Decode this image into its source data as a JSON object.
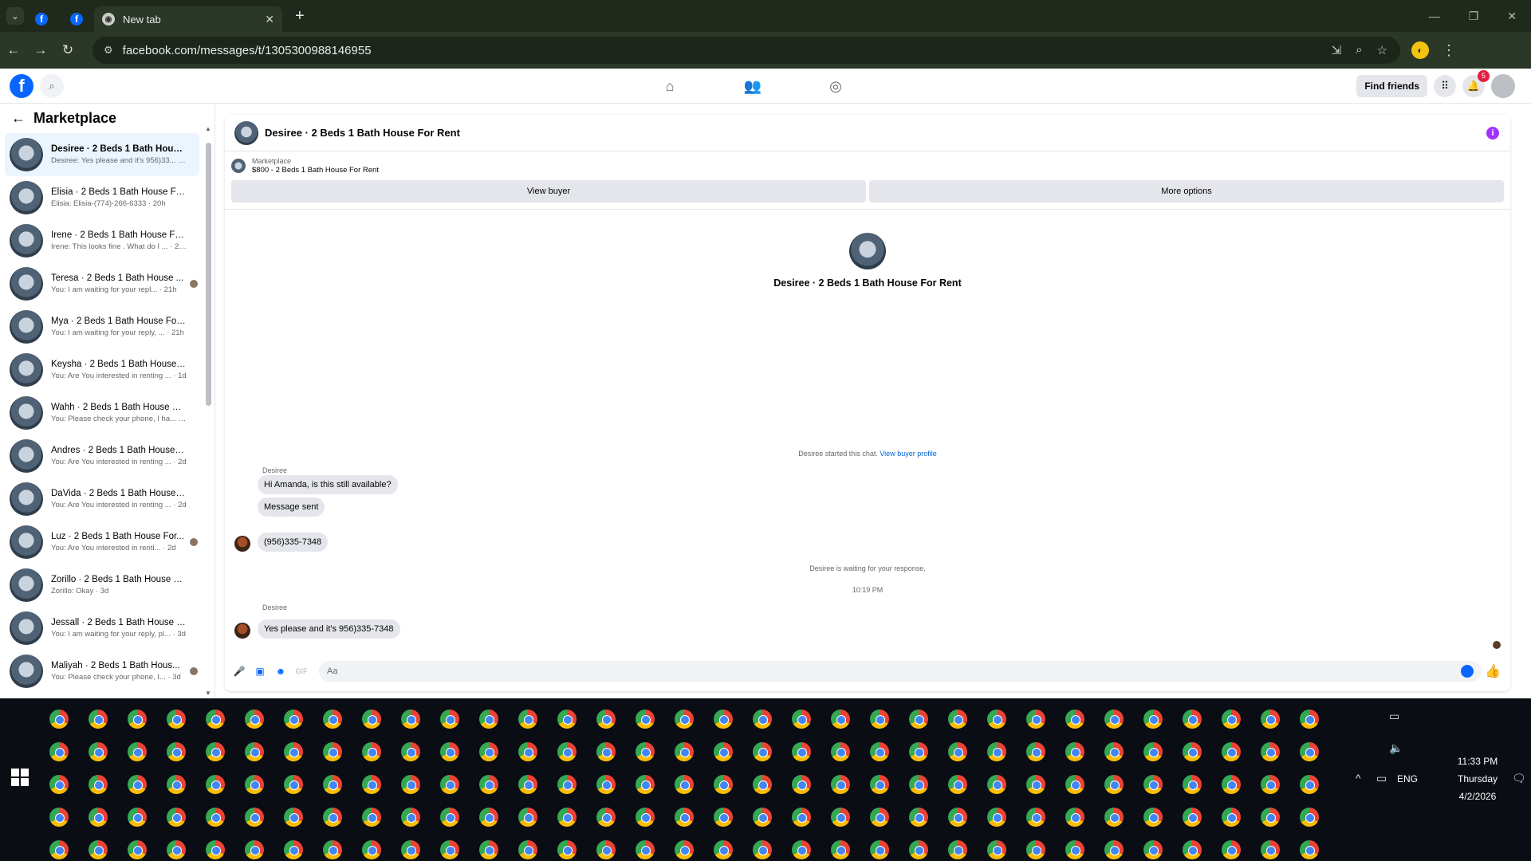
{
  "browser": {
    "tabs": [
      {
        "label": "",
        "icon": "facebook-icon"
      },
      {
        "label": "",
        "icon": "facebook-icon"
      },
      {
        "label": "New tab",
        "icon": "chrome-icon"
      }
    ],
    "url": "facebook.com/messages/t/1305300988146955"
  },
  "fb": {
    "find_friends": "Find friends",
    "notifications_count": "5"
  },
  "sidebar": {
    "title": "Marketplace",
    "conversations": [
      {
        "name": "Desiree · 2 Beds 1 Bath House F...",
        "preview": "Desiree: Yes please and it's 956)33... · 1h",
        "active": true,
        "seen": false
      },
      {
        "name": "Elisia · 2 Beds 1 Bath House For ...",
        "preview": "Elisia: Elisia-(774)-266-6333 · 20h",
        "active": false,
        "seen": false
      },
      {
        "name": "Irene · 2 Beds 1 Bath House For ...",
        "preview": "Irene: This looks fine . What do I ... · 20h",
        "active": false,
        "seen": false
      },
      {
        "name": "Teresa · 2 Beds 1 Bath House ...",
        "preview": "You: I am waiting for your repl... · 21h",
        "active": false,
        "seen": true
      },
      {
        "name": "Mya · 2 Beds 1 Bath House For ...",
        "preview": "You: I am waiting for your reply, ... · 21h",
        "active": false,
        "seen": false
      },
      {
        "name": "Keysha · 2 Beds 1 Bath House F...",
        "preview": "You: Are You interested in renting ... · 1d",
        "active": false,
        "seen": false
      },
      {
        "name": "Wahh · 2 Beds 1 Bath House For...",
        "preview": "You: Please check your phone, I ha... · 2d",
        "active": false,
        "seen": false
      },
      {
        "name": "Andres · 2 Beds 1 Bath House F...",
        "preview": "You: Are You interested in renting ... · 2d",
        "active": false,
        "seen": false
      },
      {
        "name": "DaVida · 2 Beds 1 Bath House F...",
        "preview": "You: Are You interested in renting ... · 2d",
        "active": false,
        "seen": false
      },
      {
        "name": "Luz · 2 Beds 1 Bath House For...",
        "preview": "You: Are You interested in renti... · 2d",
        "active": false,
        "seen": true
      },
      {
        "name": "Zorillo · 2 Beds 1 Bath House Fo...",
        "preview": "Zorillo: Okay · 3d",
        "active": false,
        "seen": false
      },
      {
        "name": "Jessall · 2 Beds 1 Bath House Fo...",
        "preview": "You: I am waiting for your reply, pl... · 3d",
        "active": false,
        "seen": false
      },
      {
        "name": "Maliyah · 2 Beds 1 Bath Hous...",
        "preview": "You: Please check your phone, I... · 3d",
        "active": false,
        "seen": true
      }
    ]
  },
  "chat": {
    "title": "Desiree · 2 Beds 1 Bath House For Rent",
    "listing_category": "Marketplace",
    "listing_title": "$800 - 2 Beds 1 Bath House For Rent",
    "view_buyer": "View buyer",
    "more_options": "More options",
    "thread_title": "Desiree · 2 Beds 1 Bath House For Rent",
    "started": "Desiree started this chat.",
    "view_buyer_profile": "View buyer profile",
    "sender1": "Desiree",
    "msg1": "Hi Amanda, is this still available?",
    "msg2": "Message sent",
    "msg3": "(956)335-7348",
    "waiting": "Desiree is waiting for your response.",
    "time": "10:19 PM",
    "sender2": "Desiree",
    "msg4": "Yes please and it's 956)335-7348",
    "composer_placeholder": "Aa"
  },
  "tray": {
    "lang": "ENG",
    "time": "11:33 PM",
    "day": "Thursday",
    "date": "4/2/2026"
  },
  "colors": {
    "fb_blue": "#0866ff",
    "browser_dark": "#1f2a1c",
    "taskbar": "#0a0e14"
  }
}
